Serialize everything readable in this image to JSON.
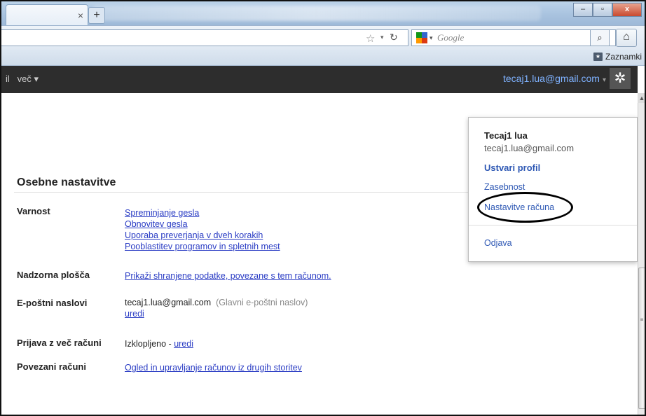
{
  "browser": {
    "tab_close": "×",
    "new_tab": "+",
    "window_buttons": {
      "minimize": "–",
      "restore": "▫",
      "close": "x"
    },
    "search_engine": "Google",
    "bookmarks_label": "Zaznamki"
  },
  "gbar": {
    "left_fragment": "il",
    "more_label": "več ▾",
    "account_email": "tecaj1.lua@gmail.com",
    "caret": "▾"
  },
  "page": {
    "heading": "Osebne nastavitve",
    "rows": {
      "security": {
        "label": "Varnost",
        "links": [
          "Spreminjanje gesla",
          "Obnovitev gesla",
          "Uporaba preverjanja v dveh korakih",
          "Pooblastitev programov in spletnih mest"
        ]
      },
      "dashboard": {
        "label": "Nadzorna plošča",
        "link": "Prikaži shranjene podatke, povezane s tem računom."
      },
      "email": {
        "label": "E-poštni naslovi",
        "address": "tecaj1.lua@gmail.com",
        "note": "(Glavni e-poštni naslov)",
        "edit": "uredi"
      },
      "multilogin": {
        "label": "Prijava z več računi",
        "status": "Izklopljeno - ",
        "edit": "uredi"
      },
      "linked": {
        "label": "Povezani računi",
        "link": "Ogled in upravljanje računov iz drugih storitev"
      }
    }
  },
  "dropdown": {
    "name": "Tecaj1 lua",
    "email": "tecaj1.lua@gmail.com",
    "create_profile": "Ustvari profil",
    "privacy": "Zasebnost",
    "account_settings": "Nastavitve računa",
    "logout": "Odjava"
  }
}
